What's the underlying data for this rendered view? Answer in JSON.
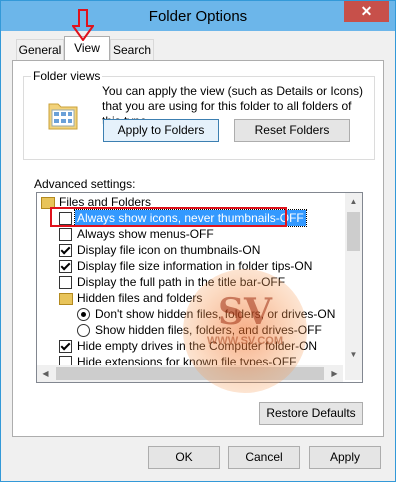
{
  "window": {
    "title": "Folder Options",
    "close_glyph": "✕"
  },
  "tabs": [
    {
      "label": "General",
      "active": false
    },
    {
      "label": "View",
      "active": true
    },
    {
      "label": "Search",
      "active": false
    }
  ],
  "folder_views": {
    "label": "Folder views",
    "description": "You can apply the view (such as Details or Icons) that you are using for this folder to all folders of this type.",
    "apply_button": "Apply to Folders",
    "reset_button": "Reset Folders"
  },
  "advanced": {
    "label": "Advanced settings:",
    "items": [
      {
        "kind": "folder",
        "text": "Files and Folders",
        "level": 0
      },
      {
        "kind": "checkbox",
        "text": "Always show icons, never thumbnails-OFF",
        "checked": false,
        "selected": true,
        "level": 1
      },
      {
        "kind": "checkbox",
        "text": "Always show menus-OFF",
        "checked": false,
        "level": 1
      },
      {
        "kind": "checkbox",
        "text": "Display file icon on thumbnails-ON",
        "checked": true,
        "level": 1
      },
      {
        "kind": "checkbox",
        "text": "Display file size information in folder tips-ON",
        "checked": true,
        "level": 1
      },
      {
        "kind": "checkbox",
        "text": "Display the full path in the title bar-OFF",
        "checked": false,
        "level": 1
      },
      {
        "kind": "folder",
        "text": "Hidden files and folders",
        "level": 1
      },
      {
        "kind": "radio",
        "text": "Don't show hidden files, folders, or drives-ON",
        "checked": true,
        "level": 2
      },
      {
        "kind": "radio",
        "text": "Show hidden files, folders, and drives-OFF",
        "checked": false,
        "level": 2
      },
      {
        "kind": "checkbox",
        "text": "Hide empty drives in the Computer folder-ON",
        "checked": true,
        "level": 1
      },
      {
        "kind": "checkbox",
        "text": "Hide extensions for known file types-OFF",
        "checked": false,
        "level": 1
      }
    ]
  },
  "restore_button": "Restore Defaults",
  "footer": {
    "ok": "OK",
    "cancel": "Cancel",
    "apply": "Apply"
  },
  "watermark": {
    "text": "SV",
    "sub": "WWW.SV.COM"
  },
  "colors": {
    "titlebar": "#6cb6ea",
    "close": "#c7504a",
    "selection": "#3399ff",
    "highlight_box": "#e0121c"
  }
}
